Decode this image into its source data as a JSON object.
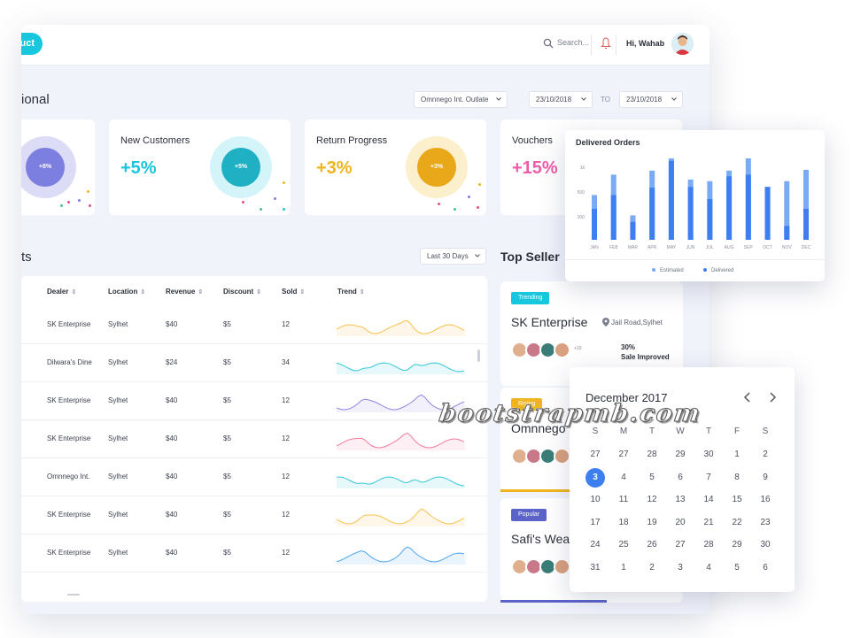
{
  "header": {
    "add_button_label": "uct",
    "search_placeholder": "Search...",
    "user_name": "Hi, Wahab"
  },
  "filters": {
    "section_title": "ional",
    "outlet": "Omnnego Int. Outlate",
    "date_from": "23/10/2018",
    "to_label": "TO",
    "date_to": "23/10/2018"
  },
  "stats": [
    {
      "title": "",
      "value": "",
      "ring_label": "+8%",
      "color": "#7c7ee0"
    },
    {
      "title": "New Customers",
      "value": "+5%",
      "ring_label": "+5%",
      "color": "#18c6de"
    },
    {
      "title": "Return Progress",
      "value": "+3%",
      "ring_label": "+3%",
      "color": "#f0b51e"
    },
    {
      "title": "Vouchers",
      "value": "+15%",
      "ring_label": "",
      "color": "#ef5da8"
    }
  ],
  "products": {
    "title": "ts",
    "range": "Last 30 Days",
    "columns": [
      "Dealer",
      "Location",
      "Revenue",
      "Discount",
      "Sold",
      "Trend"
    ],
    "rows": [
      {
        "dealer": "SK Enterprise",
        "location": "Sylhet",
        "revenue": "$40",
        "discount": "$5",
        "sold": "12",
        "trend_color": "#f8c04a"
      },
      {
        "dealer": "Dilwara's Dine",
        "location": "Sylhet",
        "revenue": "$24",
        "discount": "$5",
        "sold": "34",
        "trend_color": "#34c6d8"
      },
      {
        "dealer": "SK Enterprise",
        "location": "Sylhet",
        "revenue": "$40",
        "discount": "$5",
        "sold": "12",
        "trend_color": "#8f86e0"
      },
      {
        "dealer": "SK Enterprise",
        "location": "Sylhet",
        "revenue": "$40",
        "discount": "$5",
        "sold": "12",
        "trend_color": "#f27a9a"
      },
      {
        "dealer": "Omnnego Int.",
        "location": "Sylhet",
        "revenue": "$40",
        "discount": "$5",
        "sold": "12",
        "trend_color": "#34c6d8"
      },
      {
        "dealer": "SK Enterprise",
        "location": "Sylhet",
        "revenue": "$40",
        "discount": "$5",
        "sold": "12",
        "trend_color": "#f8c04a"
      },
      {
        "dealer": "SK Enterprise",
        "location": "Sylhet",
        "revenue": "$40",
        "discount": "$5",
        "sold": "12",
        "trend_color": "#4aa3f0"
      }
    ]
  },
  "top_seller": {
    "title": "Top Seller",
    "cards": [
      {
        "badge": "Trending",
        "badge_color": "#18c6de",
        "name": "SK Enterprise",
        "location": "Jail Road,Sylhet",
        "more": "+10",
        "pct": "30%",
        "sub": "Sale Improved",
        "bar_color": ""
      },
      {
        "badge": "Rising",
        "badge_color": "#f0b51e",
        "name": "Omnnego",
        "location": "",
        "more": "",
        "pct": "",
        "sub": "",
        "bar_color": "#f0b51e"
      },
      {
        "badge": "Popular",
        "badge_color": "#5b63c9",
        "name": "Safi's Wea",
        "location": "",
        "more": "",
        "pct": "",
        "sub": "",
        "bar_color": "#5b63c9"
      }
    ]
  },
  "chart_data": {
    "type": "bar",
    "title": "Delivered Orders",
    "categories": [
      "JAN",
      "FEB",
      "MAR",
      "APR",
      "MAY",
      "JUN",
      "JUL",
      "AUG",
      "SEP",
      "OCT",
      "NOV",
      "DEC"
    ],
    "y_ticks": [
      "1k",
      "500",
      "200"
    ],
    "series": [
      {
        "name": "Estimated",
        "color": "#79aaf4",
        "values": [
          0.55,
          0.8,
          0.3,
          0.85,
          1.0,
          0.74,
          0.72,
          0.85,
          1.0,
          0.65,
          0.72,
          0.86
        ]
      },
      {
        "name": "Delivered",
        "color": "#3d7ff0",
        "values": [
          0.38,
          0.55,
          0.22,
          0.64,
          0.97,
          0.65,
          0.5,
          0.78,
          0.8,
          0.65,
          0.17,
          0.38
        ]
      }
    ],
    "ylim": [
      0,
      1
    ]
  },
  "calendar": {
    "title": "December 2017",
    "weekdays": [
      "S",
      "M",
      "T",
      "W",
      "T",
      "F",
      "S"
    ],
    "weeks": [
      [
        "27",
        "27",
        "28",
        "29",
        "30",
        "1",
        "2"
      ],
      [
        "3",
        "4",
        "5",
        "6",
        "7",
        "8",
        "9"
      ],
      [
        "10",
        "11",
        "12",
        "13",
        "14",
        "15",
        "16"
      ],
      [
        "17",
        "18",
        "19",
        "20",
        "21",
        "22",
        "23"
      ],
      [
        "24",
        "25",
        "26",
        "27",
        "28",
        "29",
        "30"
      ],
      [
        "31",
        "1",
        "2",
        "3",
        "4",
        "5",
        "6"
      ]
    ],
    "selected": "3",
    "accent": "#3d7ff0"
  },
  "watermark": "bootstrapmb.com"
}
